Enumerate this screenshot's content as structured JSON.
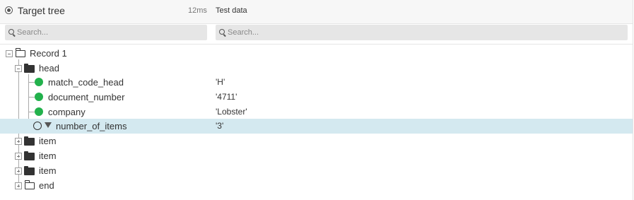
{
  "header": {
    "title": "Target tree",
    "timing": "12ms",
    "column_title": "Test data",
    "icon": "radio-icon"
  },
  "search": {
    "left_placeholder": "Search...",
    "right_placeholder": "Search..."
  },
  "tree": {
    "rows": [
      {
        "label": "Record 1",
        "value": "",
        "icon": "folder-open-icon",
        "toggle": "collapse"
      },
      {
        "label": "head",
        "value": "",
        "icon": "folder-icon",
        "toggle": "collapse"
      },
      {
        "label": "match_code_head",
        "value": "'H'",
        "icon": "green-status-icon"
      },
      {
        "label": "document_number",
        "value": "'4711'",
        "icon": "green-status-icon"
      },
      {
        "label": "company",
        "value": "'Lobster'",
        "icon": "green-status-icon"
      },
      {
        "label": "number_of_items",
        "value": "'3'",
        "icon": "empty-status-icon",
        "selected": true
      },
      {
        "label": "item",
        "value": "",
        "icon": "folder-icon",
        "toggle": "expand"
      },
      {
        "label": "item",
        "value": "",
        "icon": "folder-icon",
        "toggle": "expand"
      },
      {
        "label": "item",
        "value": "",
        "icon": "folder-icon",
        "toggle": "expand"
      },
      {
        "label": "end",
        "value": "",
        "icon": "folder-open-icon",
        "toggle": "expand"
      }
    ]
  },
  "colors": {
    "selected_row": "#d4e9f0",
    "status_green": "#22b14c",
    "header_bg": "#f7f7f7"
  }
}
